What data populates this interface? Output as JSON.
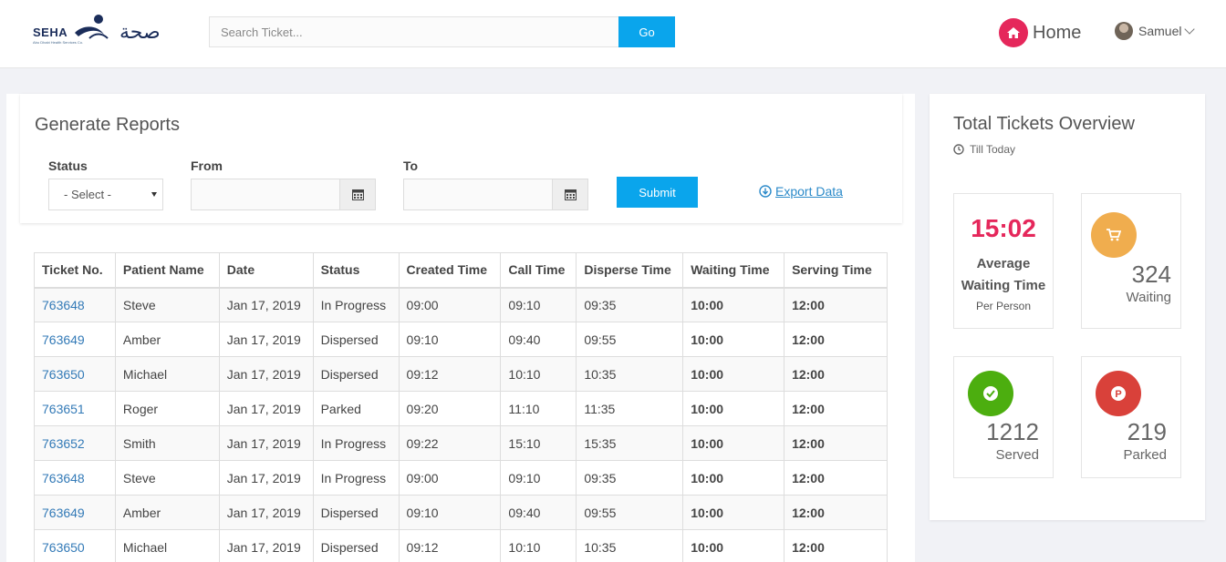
{
  "header": {
    "logo_text": "SEHA",
    "logo_subtitle": "Abu Dhabi Health Services Co.",
    "logo_arabic": "صحة",
    "search_placeholder": "Search Ticket...",
    "go_label": "Go",
    "home_label": "Home",
    "user_name": "Samuel"
  },
  "report": {
    "title": "Generate Reports",
    "status_label": "Status",
    "status_value": "- Select -",
    "from_label": "From",
    "to_label": "To",
    "submit_label": "Submit",
    "export_label": "Export Data"
  },
  "table": {
    "headers": [
      "Ticket No.",
      "Patient Name",
      "Date",
      "Status",
      "Created Time",
      "Call Time",
      "Disperse Time",
      "Waiting Time",
      "Serving Time"
    ],
    "rows": [
      [
        "763648",
        "Steve",
        "Jan 17, 2019",
        "In Progress",
        "09:00",
        "09:10",
        "09:35",
        "10:00",
        "12:00"
      ],
      [
        "763649",
        "Amber",
        "Jan 17, 2019",
        "Dispersed",
        "09:10",
        "09:40",
        "09:55",
        "10:00",
        "12:00"
      ],
      [
        "763650",
        "Michael",
        "Jan 17, 2019",
        "Dispersed",
        "09:12",
        "10:10",
        "10:35",
        "10:00",
        "12:00"
      ],
      [
        "763651",
        "Roger",
        "Jan 17, 2019",
        "Parked",
        "09:20",
        "11:10",
        "11:35",
        "10:00",
        "12:00"
      ],
      [
        "763652",
        "Smith",
        "Jan 17, 2019",
        "In Progress",
        "09:22",
        "15:10",
        "15:35",
        "10:00",
        "12:00"
      ],
      [
        "763648",
        "Steve",
        "Jan 17, 2019",
        "In Progress",
        "09:00",
        "09:10",
        "09:35",
        "10:00",
        "12:00"
      ],
      [
        "763649",
        "Amber",
        "Jan 17, 2019",
        "Dispersed",
        "09:10",
        "09:40",
        "09:55",
        "10:00",
        "12:00"
      ],
      [
        "763650",
        "Michael",
        "Jan 17, 2019",
        "Dispersed",
        "09:12",
        "10:10",
        "10:35",
        "10:00",
        "12:00"
      ]
    ]
  },
  "overview": {
    "title": "Total Tickets Overview",
    "subtitle": "Till Today",
    "avg_time": "15:02",
    "avg_label_1": "Average",
    "avg_label_2": "Waiting Time",
    "avg_per": "Per Person",
    "waiting_count": "324",
    "waiting_label": "Waiting",
    "served_count": "1212",
    "served_label": "Served",
    "parked_count": "219",
    "parked_label": "Parked",
    "colors": {
      "accent": "#e5275b",
      "waiting": "#f0ad4e",
      "served": "#4cae0f",
      "parked": "#d9413a",
      "primary": "#0aa5ec"
    }
  }
}
